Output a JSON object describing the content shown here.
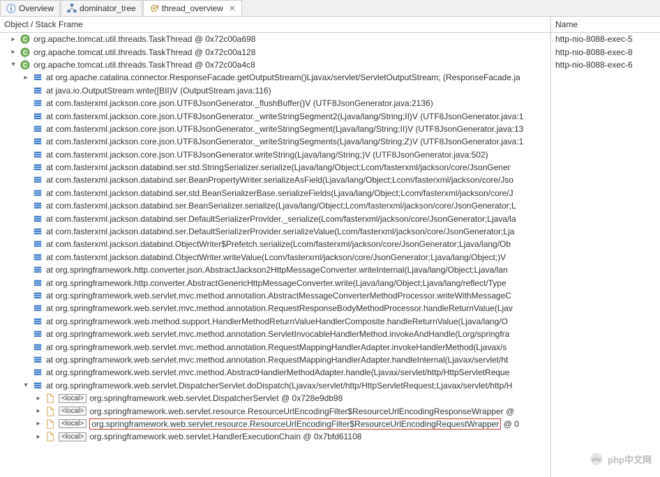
{
  "tabs": [
    {
      "label": "Overview"
    },
    {
      "label": "dominator_tree"
    },
    {
      "label": "thread_overview"
    }
  ],
  "left_header": "Object / Stack Frame",
  "right_header": "Name",
  "names": [
    "http-nio-8088-exec-5",
    "http-nio-8088-exec-8",
    "http-nio-8088-exec-6"
  ],
  "local_tag": "<local>",
  "rows": [
    {
      "indent": 0,
      "twisty": "closed",
      "icon": "class",
      "text": "org.apache.tomcat.util.threads.TaskThread @ 0x72c00a698"
    },
    {
      "indent": 0,
      "twisty": "closed",
      "icon": "class",
      "text": "org.apache.tomcat.util.threads.TaskThread @ 0x72c00a128"
    },
    {
      "indent": 0,
      "twisty": "open",
      "icon": "class",
      "text": "org.apache.tomcat.util.threads.TaskThread @ 0x72c00a4c8"
    },
    {
      "indent": 1,
      "twisty": "closed",
      "icon": "frame",
      "text": "at org.apache.catalina.connector.ResponseFacade.getOutputStream()Ljavax/servlet/ServletOutputStream; (ResponseFacade.ja"
    },
    {
      "indent": 1,
      "twisty": "none",
      "icon": "frame",
      "text": "at java.io.OutputStream.write([BII)V (OutputStream.java:116)"
    },
    {
      "indent": 1,
      "twisty": "none",
      "icon": "frame",
      "text": "at com.fasterxml.jackson.core.json.UTF8JsonGenerator._flushBuffer()V (UTF8JsonGenerator.java:2136)"
    },
    {
      "indent": 1,
      "twisty": "none",
      "icon": "frame",
      "text": "at com.fasterxml.jackson.core.json.UTF8JsonGenerator._writeStringSegment2(Ljava/lang/String;II)V (UTF8JsonGenerator.java:1"
    },
    {
      "indent": 1,
      "twisty": "none",
      "icon": "frame",
      "text": "at com.fasterxml.jackson.core.json.UTF8JsonGenerator._writeStringSegment(Ljava/lang/String;II)V (UTF8JsonGenerator.java:13"
    },
    {
      "indent": 1,
      "twisty": "none",
      "icon": "frame",
      "text": "at com.fasterxml.jackson.core.json.UTF8JsonGenerator._writeStringSegments(Ljava/lang/String;Z)V (UTF8JsonGenerator.java:1"
    },
    {
      "indent": 1,
      "twisty": "none",
      "icon": "frame",
      "text": "at com.fasterxml.jackson.core.json.UTF8JsonGenerator.writeString(Ljava/lang/String;)V (UTF8JsonGenerator.java:502)"
    },
    {
      "indent": 1,
      "twisty": "none",
      "icon": "frame",
      "text": "at com.fasterxml.jackson.databind.ser.std.StringSerializer.serialize(Ljava/lang/Object;Lcom/fasterxml/jackson/core/JsonGener"
    },
    {
      "indent": 1,
      "twisty": "none",
      "icon": "frame",
      "text": "at com.fasterxml.jackson.databind.ser.BeanPropertyWriter.serializeAsField(Ljava/lang/Object;Lcom/fasterxml/jackson/core/Jso"
    },
    {
      "indent": 1,
      "twisty": "none",
      "icon": "frame",
      "text": "at com.fasterxml.jackson.databind.ser.std.BeanSerializerBase.serializeFields(Ljava/lang/Object;Lcom/fasterxml/jackson/core/J"
    },
    {
      "indent": 1,
      "twisty": "none",
      "icon": "frame",
      "text": "at com.fasterxml.jackson.databind.ser.BeanSerializer.serialize(Ljava/lang/Object;Lcom/fasterxml/jackson/core/JsonGenerator;L"
    },
    {
      "indent": 1,
      "twisty": "none",
      "icon": "frame",
      "text": "at com.fasterxml.jackson.databind.ser.DefaultSerializerProvider._serialize(Lcom/fasterxml/jackson/core/JsonGenerator;Ljava/la"
    },
    {
      "indent": 1,
      "twisty": "none",
      "icon": "frame",
      "text": "at com.fasterxml.jackson.databind.ser.DefaultSerializerProvider.serializeValue(Lcom/fasterxml/jackson/core/JsonGenerator;Lja"
    },
    {
      "indent": 1,
      "twisty": "none",
      "icon": "frame",
      "text": "at com.fasterxml.jackson.databind.ObjectWriter$Prefetch.serialize(Lcom/fasterxml/jackson/core/JsonGenerator;Ljava/lang/Ob"
    },
    {
      "indent": 1,
      "twisty": "none",
      "icon": "frame",
      "text": "at com.fasterxml.jackson.databind.ObjectWriter.writeValue(Lcom/fasterxml/jackson/core/JsonGenerator;Ljava/lang/Object;)V"
    },
    {
      "indent": 1,
      "twisty": "none",
      "icon": "frame",
      "text": "at org.springframework.http.converter.json.AbstractJackson2HttpMessageConverter.writeInternal(Ljava/lang/Object;Ljava/lan"
    },
    {
      "indent": 1,
      "twisty": "none",
      "icon": "frame",
      "text": "at org.springframework.http.converter.AbstractGenericHttpMessageConverter.write(Ljava/lang/Object;Ljava/lang/reflect/Type"
    },
    {
      "indent": 1,
      "twisty": "none",
      "icon": "frame",
      "text": "at org.springframework.web.servlet.mvc.method.annotation.AbstractMessageConverterMethodProcessor.writeWithMessageC"
    },
    {
      "indent": 1,
      "twisty": "none",
      "icon": "frame",
      "text": "at org.springframework.web.servlet.mvc.method.annotation.RequestResponseBodyMethodProcessor.handleReturnValue(Ljav"
    },
    {
      "indent": 1,
      "twisty": "none",
      "icon": "frame",
      "text": "at org.springframework.web.method.support.HandlerMethodReturnValueHandlerComposite.handleReturnValue(Ljava/lang/O"
    },
    {
      "indent": 1,
      "twisty": "none",
      "icon": "frame",
      "text": "at org.springframework.web.servlet.mvc.method.annotation.ServletInvocableHandlerMethod.invokeAndHandle(Lorg/springfra"
    },
    {
      "indent": 1,
      "twisty": "none",
      "icon": "frame",
      "text": "at org.springframework.web.servlet.mvc.method.annotation.RequestMappingHandlerAdapter.invokeHandlerMethod(Ljavax/s"
    },
    {
      "indent": 1,
      "twisty": "none",
      "icon": "frame",
      "text": "at org.springframework.web.servlet.mvc.method.annotation.RequestMappingHandlerAdapter.handleInternal(Ljavax/servlet/ht"
    },
    {
      "indent": 1,
      "twisty": "none",
      "icon": "frame",
      "text": "at org.springframework.web.servlet.mvc.method.AbstractHandlerMethodAdapter.handle(Ljavax/servlet/http/HttpServletReque"
    },
    {
      "indent": 1,
      "twisty": "open",
      "icon": "frame",
      "text": "at org.springframework.web.servlet.DispatcherServlet.doDispatch(Ljavax/servlet/http/HttpServletRequest;Ljavax/servlet/http/H"
    },
    {
      "indent": 2,
      "twisty": "closed",
      "icon": "file",
      "local": true,
      "text": "org.springframework.web.servlet.DispatcherServlet @ 0x728e9db98"
    },
    {
      "indent": 2,
      "twisty": "closed",
      "icon": "file",
      "local": true,
      "text": "org.springframework.web.servlet.resource.ResourceUrlEncodingFilter$ResourceUrlEncodingResponseWrapper @"
    },
    {
      "indent": 2,
      "twisty": "closed",
      "icon": "file",
      "local": true,
      "highlight": true,
      "text": "org.springframework.web.servlet.resource.ResourceUrlEncodingFilter$ResourceUrlEncodingRequestWrapper",
      "suffix": " @ 0"
    },
    {
      "indent": 2,
      "twisty": "closed",
      "icon": "file",
      "local": true,
      "text": "org.springframework.web.servlet.HandlerExecutionChain @ 0x7bfd61108"
    }
  ],
  "watermark": "php中文网"
}
